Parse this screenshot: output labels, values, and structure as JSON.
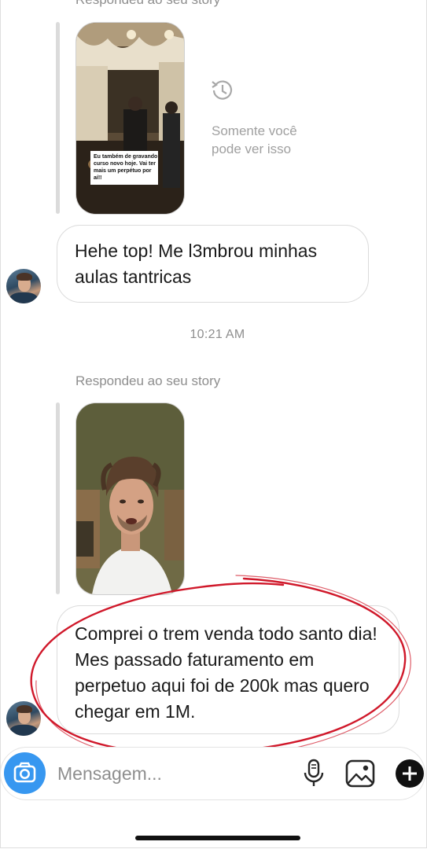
{
  "thread": {
    "reply_label_1": "Respondeu ao seu story",
    "story1_caption": "Eu também de gravando curso novo hoje. Vai ter mais um perpétuo por aí!!",
    "only_you": "Somente você pode ver isso",
    "message_1": "Hehe top! Me l3mbrou minhas aulas tantricas",
    "timestamp": "10:21 AM",
    "reply_label_2": "Respondeu ao seu story",
    "message_2": "Comprei o trem venda todo santo dia! Mes passado faturamento em perpetuo aqui foi de 200k mas quero chegar em 1M."
  },
  "composer": {
    "placeholder": "Mensagem..."
  },
  "colors": {
    "accent": "#3797f0",
    "annotation": "#d0182a"
  }
}
